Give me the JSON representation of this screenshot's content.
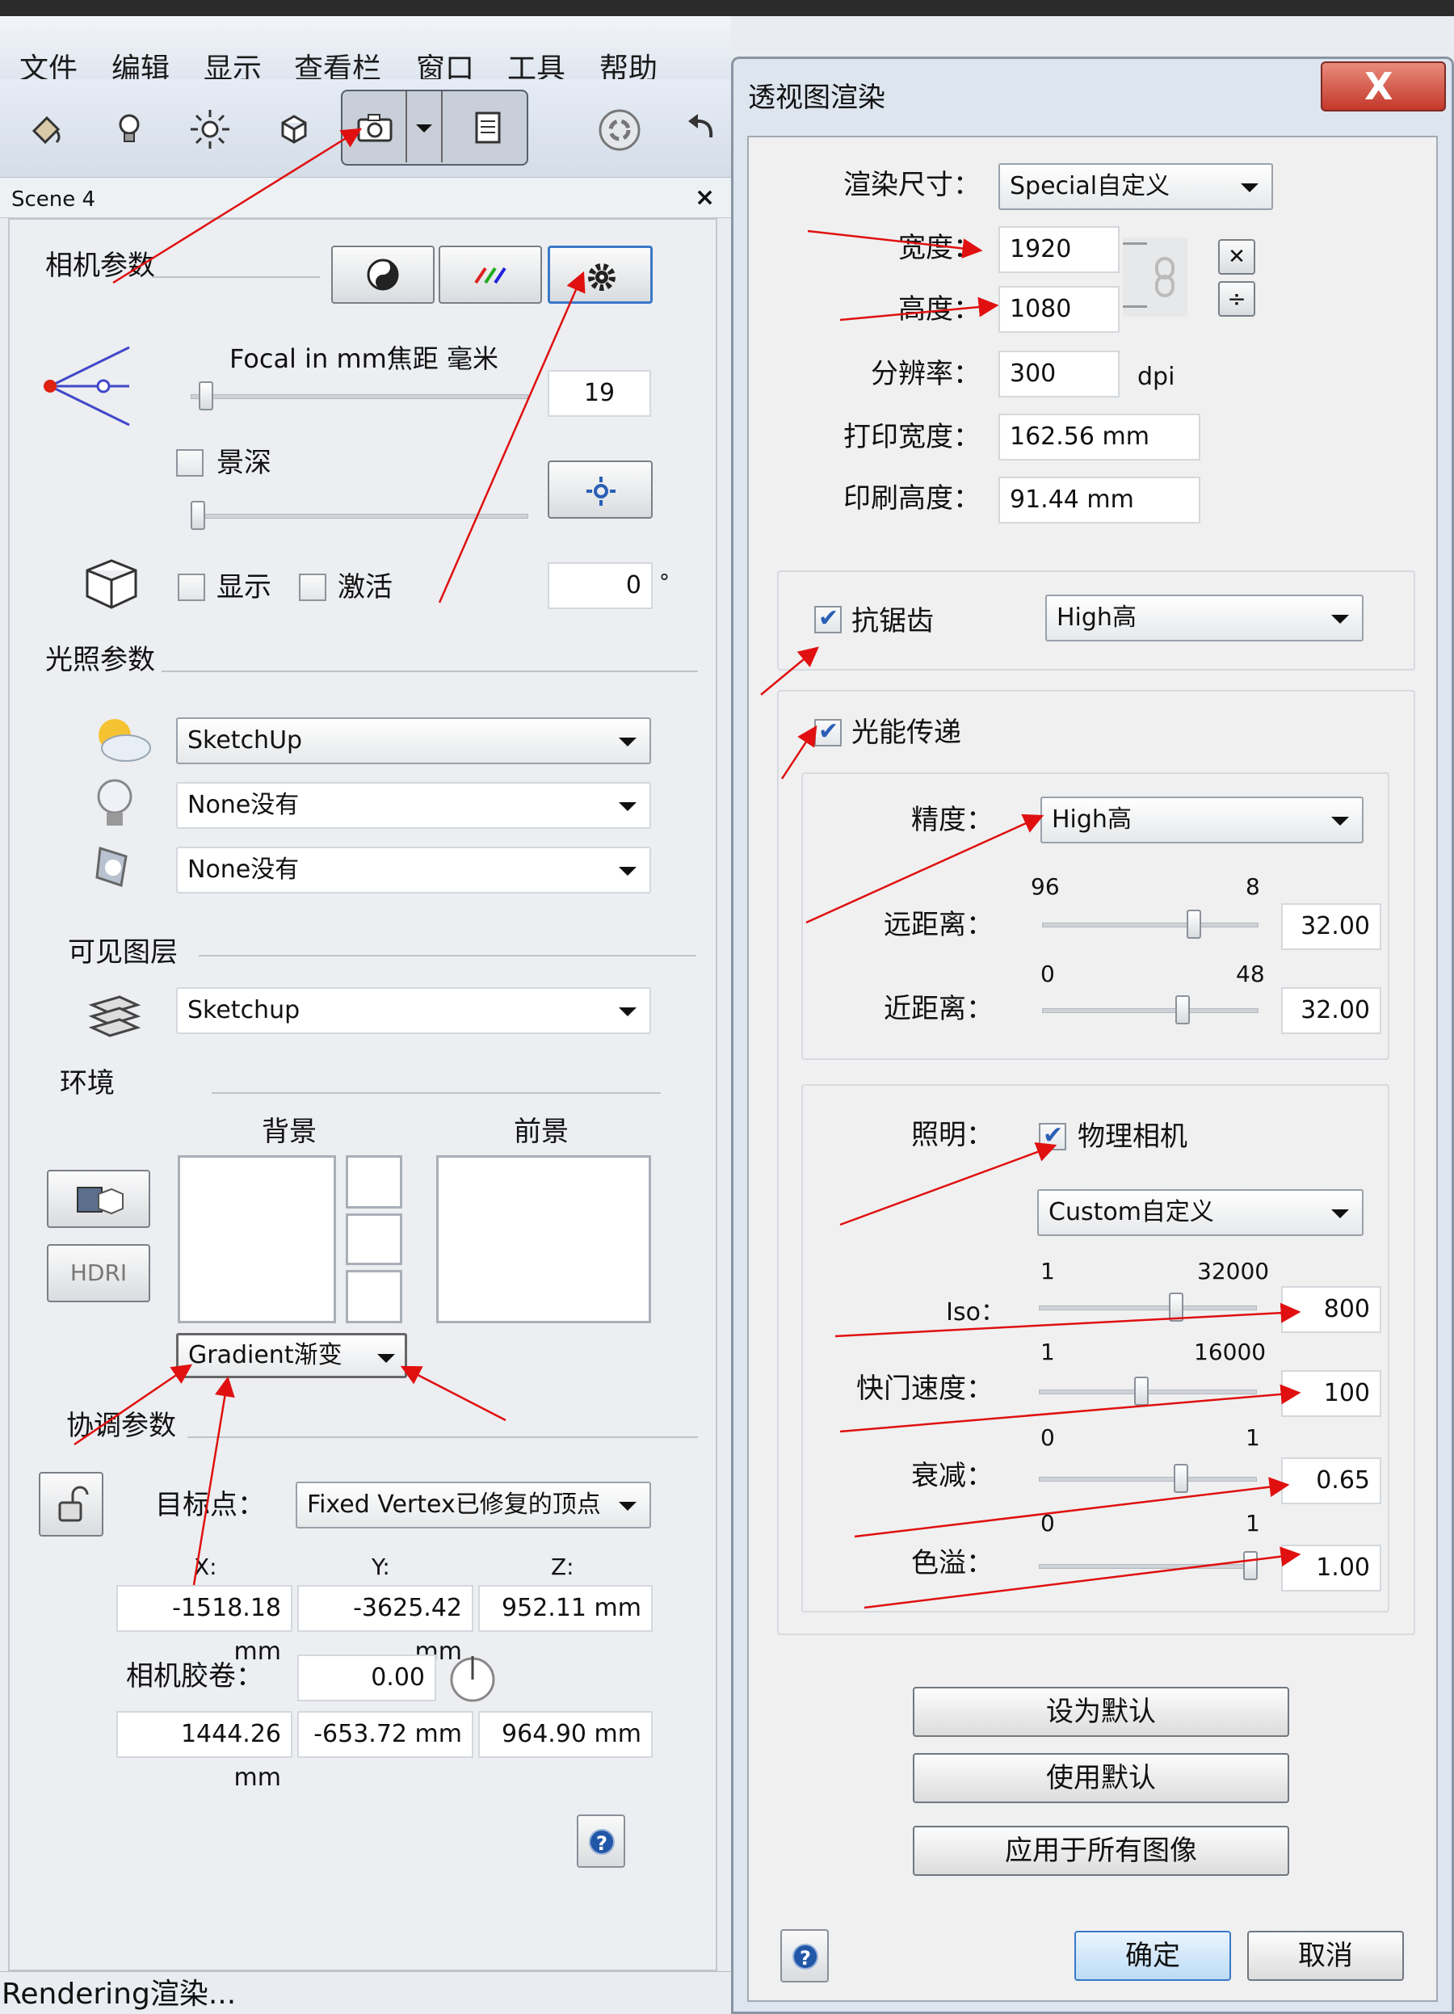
{
  "menu": [
    "文件",
    "编辑",
    "显示",
    "查看栏",
    "窗口",
    "工具",
    "帮助"
  ],
  "scene": {
    "title": "Scene 4",
    "close": "×"
  },
  "camera": {
    "section": "相机参数",
    "focal_label": "Focal in mm焦距 毫米",
    "focal_value": "19",
    "dof_label": "景深",
    "show_label": "显示",
    "activate_label": "激活",
    "angle_value": "0",
    "angle_unit": "°"
  },
  "lighting": {
    "section": "光照参数",
    "sun": "SketchUp",
    "light1": "None没有",
    "light2": "None没有"
  },
  "layers": {
    "section": "可见图层",
    "value": "Sketchup"
  },
  "environment": {
    "section": "环境",
    "background": "背景",
    "foreground": "前景",
    "hdri": "HDRI",
    "mode": "Gradient渐变"
  },
  "coord": {
    "section": "协调参数",
    "target_label": "目标点：",
    "target_value": "Fixed Vertex已修复的顶点",
    "x": "X:",
    "y": "Y:",
    "z": "Z:",
    "tx": "-1518.18 mm",
    "ty": "-3625.42 mm",
    "tz": "952.11 mm",
    "film_label": "相机胶卷：",
    "film_value": "0.00",
    "cx": "1444.26 mm",
    "cy": "-653.72 mm",
    "cz": "964.90 mm"
  },
  "status": "Rendering渲染...",
  "dialog": {
    "title": "透视图渲染",
    "close": "X",
    "size_label": "渲染尺寸：",
    "size_value": "Special自定义",
    "width_label": "宽度：",
    "width_value": "1920",
    "height_label": "高度：",
    "height_value": "1080",
    "res_label": "分辨率：",
    "res_value": "300",
    "res_unit": "dpi",
    "print_w_label": "打印宽度：",
    "print_w_value": "162.56 mm",
    "print_h_label": "印刷高度：",
    "print_h_value": "91.44 mm",
    "aa_label": "抗锯齿",
    "aa_value": "High高",
    "radiosity_label": "光能传递",
    "precision_label": "精度：",
    "precision_value": "High高",
    "far_label": "远距离：",
    "far_min": "96",
    "far_max": "8",
    "far_value": "32.00",
    "far_level": 0.7,
    "near_label": "近距离：",
    "near_min": "0",
    "near_max": "48",
    "near_value": "32.00",
    "near_level": 0.65,
    "lighting_label": "照明：",
    "physcam_label": "物理相机",
    "lighting_value": "Custom自定义",
    "iso_label": "Iso：",
    "iso_min": "1",
    "iso_max": "32000",
    "iso_value": "800",
    "iso_level": 0.63,
    "shutter_label": "快门速度：",
    "shutter_min": "1",
    "shutter_max": "16000",
    "shutter_value": "100",
    "shutter_level": 0.47,
    "decay_label": "衰减：",
    "decay_min": "0",
    "decay_max": "1",
    "decay_value": "0.65",
    "decay_level": 0.65,
    "bleed_label": "色溢：",
    "bleed_min": "0",
    "bleed_max": "1",
    "bleed_value": "1.00",
    "bleed_level": 0.97,
    "set_default": "设为默认",
    "use_default": "使用默认",
    "apply_all": "应用于所有图像",
    "ok": "确定",
    "cancel": "取消"
  },
  "colors": {
    "accent": "#2a5fb5",
    "arrow": "#e01010",
    "close": "#c4382a"
  }
}
